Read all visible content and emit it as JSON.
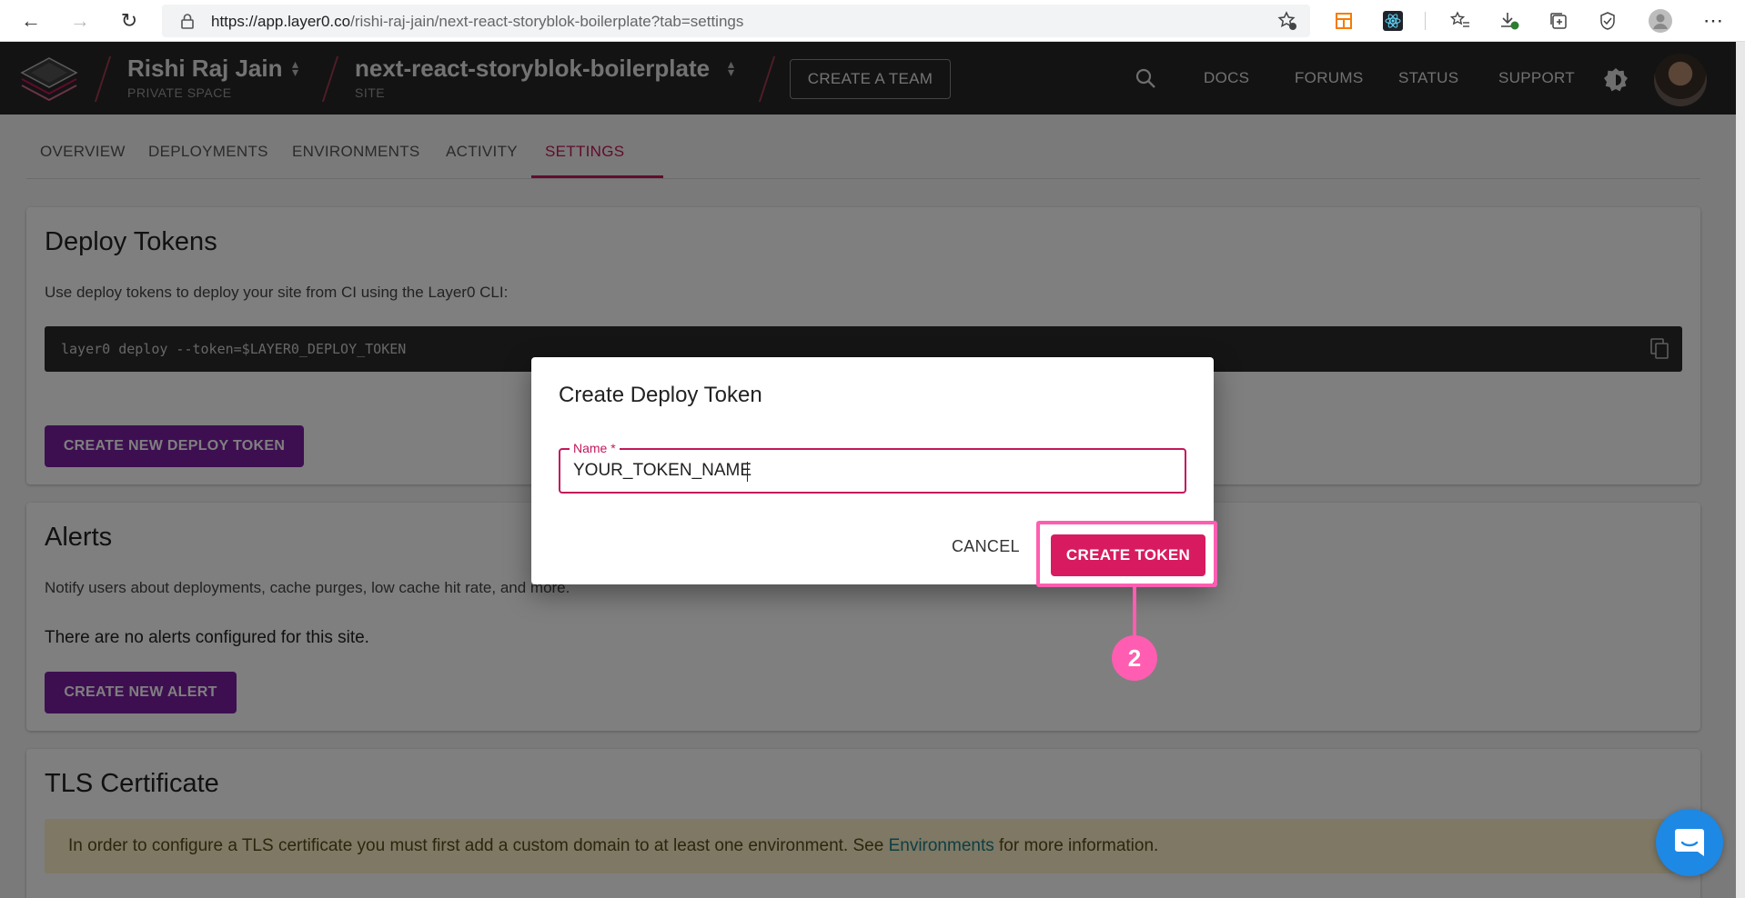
{
  "browser": {
    "url_host": "https://app.layer0.co",
    "url_path": "/rishi-raj-jain/next-react-storyblok-boilerplate?tab=settings"
  },
  "header": {
    "team_name": "Rishi Raj Jain",
    "team_sub": "PRIVATE SPACE",
    "site_name": "next-react-storyblok-boilerplate",
    "site_sub": "SITE",
    "create_team": "CREATE A TEAM",
    "links": [
      "DOCS",
      "FORUMS",
      "STATUS",
      "SUPPORT"
    ]
  },
  "tabs": [
    "OVERVIEW",
    "DEPLOYMENTS",
    "ENVIRONMENTS",
    "ACTIVITY",
    "SETTINGS"
  ],
  "deploy_tokens": {
    "title": "Deploy Tokens",
    "description": "Use deploy tokens to deploy your site from CI using the Layer0 CLI:",
    "command": "layer0 deploy --token=$LAYER0_DEPLOY_TOKEN",
    "button": "CREATE NEW DEPLOY TOKEN"
  },
  "alerts": {
    "title": "Alerts",
    "description": "Notify users about deployments, cache purges, low cache hit rate, and more.",
    "empty": "There are no alerts configured for this site.",
    "button": "CREATE NEW ALERT"
  },
  "tls": {
    "title": "TLS Certificate",
    "banner_pre": "In order to configure a TLS certificate you must first add a custom domain to at least one environment. See ",
    "banner_link": "Environments",
    "banner_post": " for more information."
  },
  "dialog": {
    "title": "Create Deploy Token",
    "field_label": "Name *",
    "field_value": "YOUR_TOKEN_NAME",
    "cancel": "CANCEL",
    "confirm": "CREATE TOKEN"
  },
  "annotation": {
    "step": "2"
  },
  "colors": {
    "accent": "#c2185b",
    "purple": "#7b1fa2",
    "highlight": "#ff5db1"
  }
}
